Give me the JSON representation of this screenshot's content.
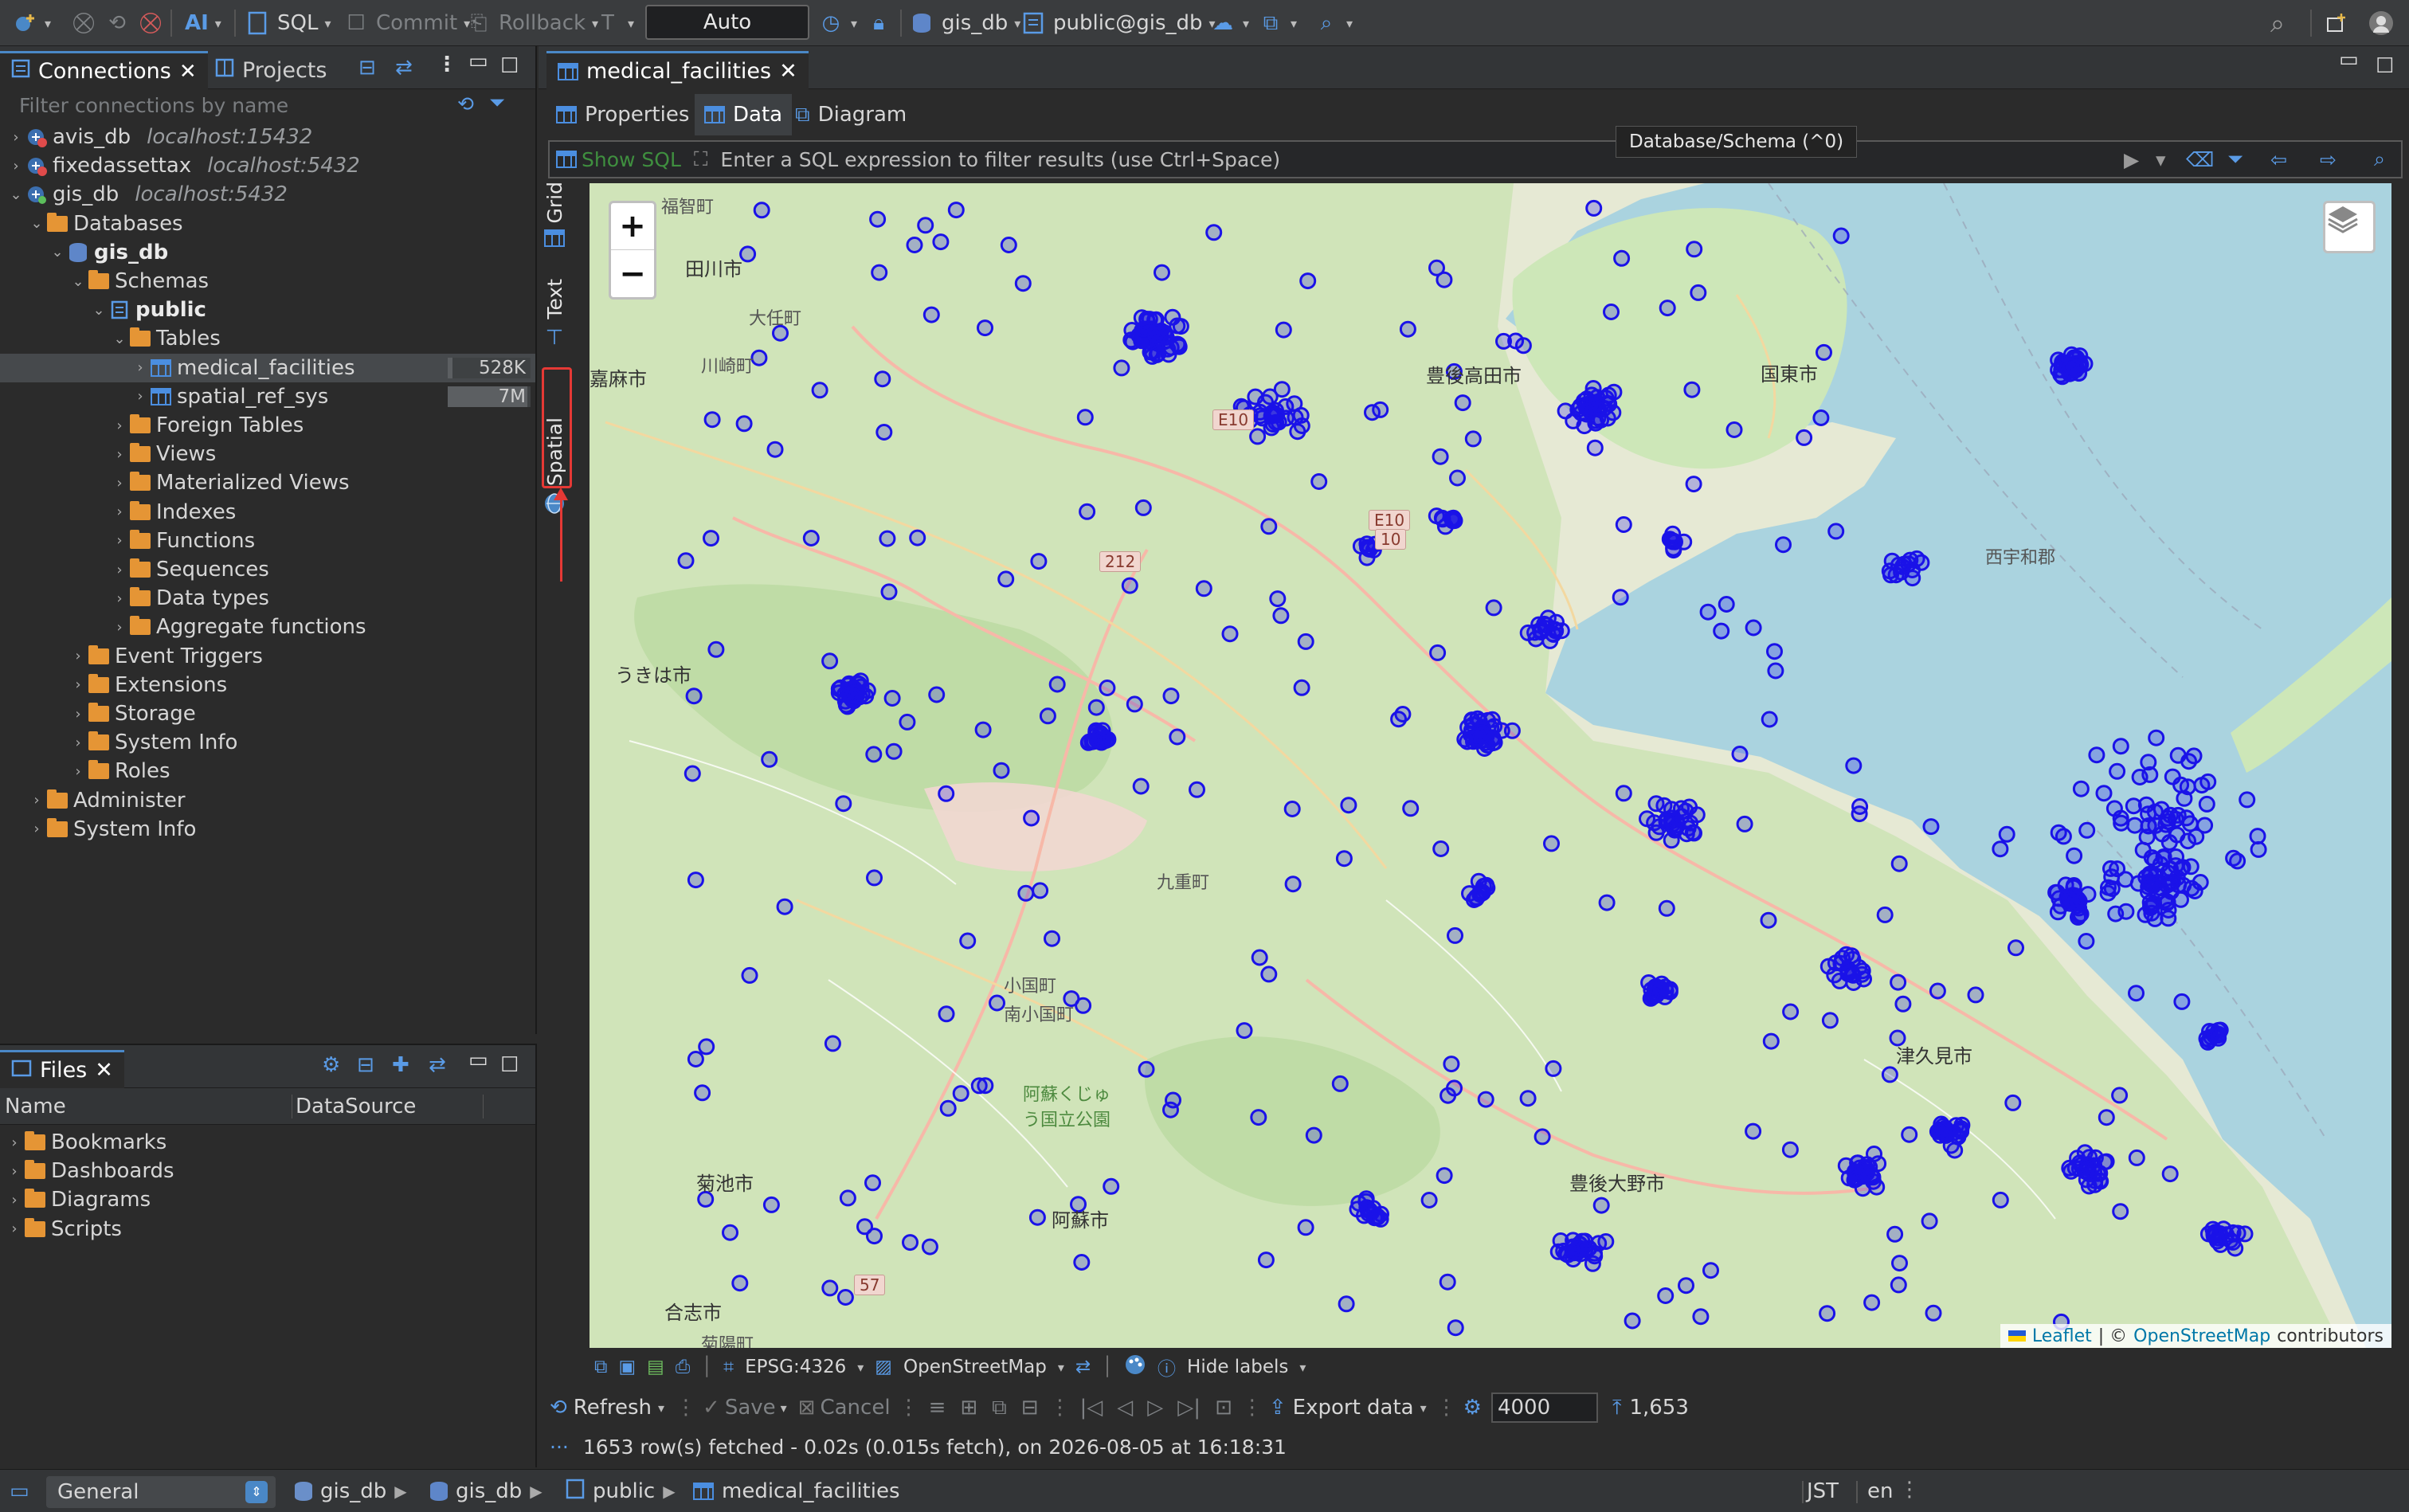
{
  "toolbar": {
    "sql_label": "SQL",
    "commit_label": "Commit",
    "rollback_label": "Rollback",
    "ai_label": "AI",
    "transaction_mode": "Auto",
    "datasource": "gis_db",
    "schema": "public@gis_db"
  },
  "connections_panel": {
    "tab_connections": "Connections",
    "tab_projects": "Projects",
    "filter_placeholder": "Filter connections by name",
    "tree": [
      {
        "label": "avis_db",
        "host": "localhost:15432",
        "level": 0,
        "kind": "conn-error",
        "expanded": false
      },
      {
        "label": "fixedassettax",
        "host": "localhost:5432",
        "level": 0,
        "kind": "conn-error",
        "expanded": false
      },
      {
        "label": "gis_db",
        "host": "localhost:5432",
        "level": 0,
        "kind": "conn-ok",
        "expanded": true
      },
      {
        "label": "Databases",
        "level": 1,
        "kind": "folder",
        "expanded": true
      },
      {
        "label": "gis_db",
        "level": 2,
        "kind": "database",
        "expanded": true,
        "bold": true
      },
      {
        "label": "Schemas",
        "level": 3,
        "kind": "folder",
        "expanded": true
      },
      {
        "label": "public",
        "level": 4,
        "kind": "schema",
        "expanded": true,
        "bold": true
      },
      {
        "label": "Tables",
        "level": 5,
        "kind": "folder",
        "expanded": true
      },
      {
        "label": "medical_facilities",
        "level": 6,
        "kind": "table",
        "expanded": false,
        "size": "528K",
        "selected": true
      },
      {
        "label": "spatial_ref_sys",
        "level": 6,
        "kind": "table",
        "expanded": false,
        "size": "7M"
      },
      {
        "label": "Foreign Tables",
        "level": 5,
        "kind": "folder",
        "expanded": false
      },
      {
        "label": "Views",
        "level": 5,
        "kind": "folder",
        "expanded": false
      },
      {
        "label": "Materialized Views",
        "level": 5,
        "kind": "folder",
        "expanded": false
      },
      {
        "label": "Indexes",
        "level": 5,
        "kind": "folder",
        "expanded": false
      },
      {
        "label": "Functions",
        "level": 5,
        "kind": "folder",
        "expanded": false
      },
      {
        "label": "Sequences",
        "level": 5,
        "kind": "folder",
        "expanded": false
      },
      {
        "label": "Data types",
        "level": 5,
        "kind": "folder",
        "expanded": false
      },
      {
        "label": "Aggregate functions",
        "level": 5,
        "kind": "folder",
        "expanded": false
      },
      {
        "label": "Event Triggers",
        "level": 3,
        "kind": "folder",
        "expanded": false
      },
      {
        "label": "Extensions",
        "level": 3,
        "kind": "folder",
        "expanded": false
      },
      {
        "label": "Storage",
        "level": 3,
        "kind": "folder",
        "expanded": false
      },
      {
        "label": "System Info",
        "level": 3,
        "kind": "folder",
        "expanded": false
      },
      {
        "label": "Roles",
        "level": 3,
        "kind": "folder",
        "expanded": false
      },
      {
        "label": "Administer",
        "level": 1,
        "kind": "folder",
        "expanded": false
      },
      {
        "label": "System Info",
        "level": 1,
        "kind": "folder",
        "expanded": false
      }
    ]
  },
  "files_panel": {
    "tab_label": "Files",
    "col_name": "Name",
    "col_datasource": "DataSource",
    "items": [
      "Bookmarks",
      "Dashboards",
      "Diagrams",
      "Scripts"
    ]
  },
  "editor": {
    "tab_label": "medical_facilities",
    "subtabs": [
      "Properties",
      "Data",
      "Diagram"
    ],
    "active_subtab": "Data",
    "tooltip": "Database/Schema (^0)",
    "show_sql": "Show SQL",
    "filter_placeholder": "Enter a SQL expression to filter results (use Ctrl+Space)",
    "side_tabs": [
      "Grid",
      "Text",
      "Spatial"
    ],
    "active_side_tab": "Spatial"
  },
  "map": {
    "zoom_in": "+",
    "zoom_out": "−",
    "attribution_leaflet": "Leaflet",
    "attribution_sep": "|  ©",
    "attribution_osm": "OpenStreetMap",
    "attribution_tail": "contributors",
    "marker_color": "#1a12e8",
    "labels": [
      {
        "text": "福智町",
        "kind": "town"
      },
      {
        "text": "田川市",
        "kind": "city"
      },
      {
        "text": "大任町",
        "kind": "town"
      },
      {
        "text": "川崎町",
        "kind": "town"
      },
      {
        "text": "嘉麻市",
        "kind": "city"
      },
      {
        "text": "うきは市",
        "kind": "city"
      },
      {
        "text": "小国町",
        "kind": "town"
      },
      {
        "text": "南小国町",
        "kind": "town"
      },
      {
        "text": "九重町",
        "kind": "town"
      },
      {
        "text": "菊池市",
        "kind": "city"
      },
      {
        "text": "阿蘇市",
        "kind": "city"
      },
      {
        "text": "合志市",
        "kind": "city"
      },
      {
        "text": "菊陽町",
        "kind": "town"
      },
      {
        "text": "国東市",
        "kind": "city"
      },
      {
        "text": "豊後高田市",
        "kind": "city"
      },
      {
        "text": "西宇和郡",
        "kind": "town"
      },
      {
        "text": "津久見市",
        "kind": "city"
      },
      {
        "text": "豊後大野市",
        "kind": "city"
      },
      {
        "text": "阿蘇くじゅう国立公園",
        "kind": "park"
      }
    ],
    "road_shields": [
      "E10",
      "E10",
      "10",
      "212",
      "57"
    ]
  },
  "map_toolbar": {
    "crs": "EPSG:4326",
    "tiles": "OpenStreetMap",
    "hide_labels": "Hide labels"
  },
  "results_toolbar": {
    "refresh": "Refresh",
    "save": "Save",
    "cancel": "Cancel",
    "export": "Export data",
    "fetch_size": "4000",
    "row_count": "1,653"
  },
  "status_line": "1653 row(s) fetched - 0.02s (0.015s fetch), on 2026-08-05 at 16:18:31",
  "statusbar": {
    "workspace": "General",
    "crumbs": [
      "gis_db",
      "gis_db",
      "public",
      "medical_facilities"
    ],
    "timezone": "JST",
    "locale": "en"
  }
}
